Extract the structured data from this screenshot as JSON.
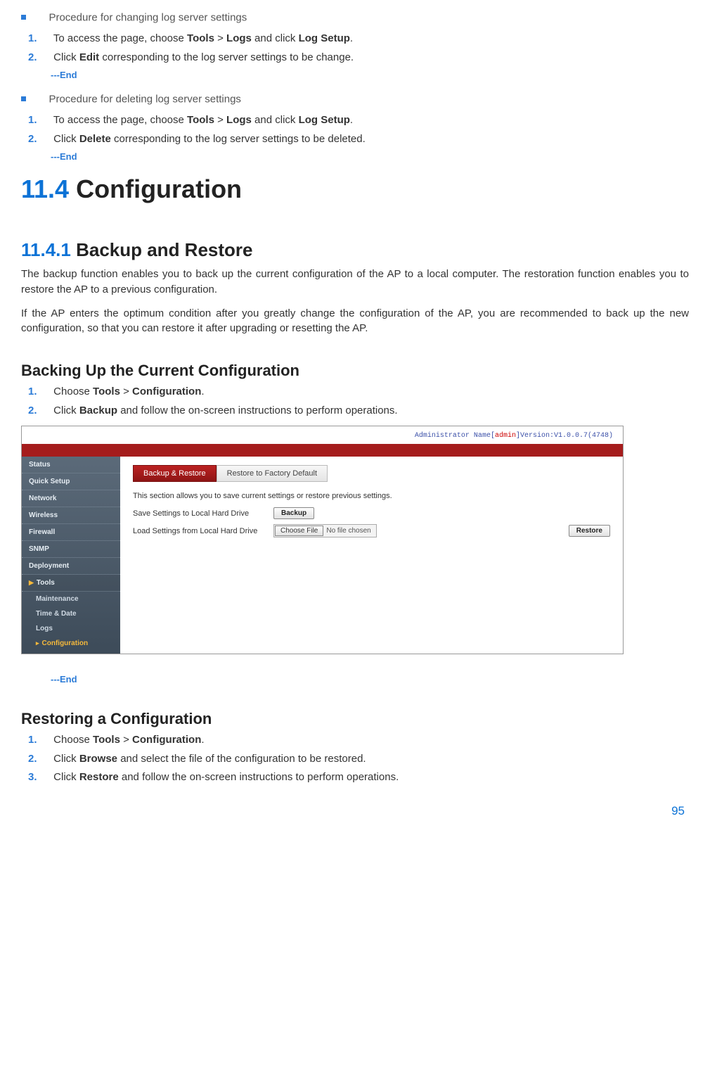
{
  "proc1": {
    "title": "Procedure for changing log server settings",
    "step1_pre": "To access the page, choose ",
    "step1_b1": "Tools",
    "step1_mid1": " > ",
    "step1_b2": "Logs",
    "step1_mid2": " and click ",
    "step1_b3": "Log Setup",
    "step1_tail": ".",
    "step2_pre": "Click ",
    "step2_b1": "Edit",
    "step2_tail": " corresponding to the log server settings to be change.",
    "end": "---End"
  },
  "proc2": {
    "title": "Procedure for deleting log server settings",
    "step1_pre": "To access the page, choose ",
    "step1_b1": "Tools",
    "step1_mid1": " > ",
    "step1_b2": "Logs",
    "step1_mid2": " and click ",
    "step1_b3": "Log Setup",
    "step1_tail": ".",
    "step2_pre": "Click ",
    "step2_b1": "Delete",
    "step2_tail": " corresponding to the log server settings to be deleted.",
    "end": "---End"
  },
  "sec": {
    "num": "11.4",
    "title": "  Configuration"
  },
  "sub": {
    "num": "11.4.1",
    "title": "  Backup and Restore"
  },
  "paras": {
    "p1": "The backup function enables you to back up the current configuration of the AP to a local computer. The restoration function enables you to restore the AP to a previous configuration.",
    "p2": "If the AP enters the optimum condition after you greatly change the configuration of the AP, you are recommended to back up the new configuration, so that you can restore it after upgrading or resetting the AP."
  },
  "backup": {
    "heading": "Backing Up the Current Configuration",
    "step1_pre": "Choose ",
    "step1_b1": "Tools",
    "step1_mid1": " > ",
    "step1_b2": "Configuration",
    "step1_tail": ".",
    "step2_pre": "Click ",
    "step2_b1": "Backup",
    "step2_tail": " and follow the on-screen instructions to perform operations.",
    "end": "---End"
  },
  "shot": {
    "admin_label_pre": "Administrator Name[",
    "admin_name": "admin",
    "admin_label_post": "]Version:V1.0.0.7(4748)",
    "side": {
      "status": "Status",
      "quick": "Quick Setup",
      "network": "Network",
      "wireless": "Wireless",
      "firewall": "Firewall",
      "snmp": "SNMP",
      "deployment": "Deployment",
      "tools": "Tools",
      "maintenance": "Maintenance",
      "timedate": "Time & Date",
      "logs": "Logs",
      "configuration": "Configuration"
    },
    "tabs": {
      "backup": "Backup & Restore",
      "factory": "Restore to Factory Default"
    },
    "desc": "This section allows you to save current settings or restore previous settings.",
    "row1_label": "Save Settings to Local Hard Drive",
    "row1_btn": "Backup",
    "row2_label": "Load Settings from Local Hard Drive",
    "row2_choose": "Choose File",
    "row2_nofile": "No file chosen",
    "row2_btn": "Restore"
  },
  "restore": {
    "heading": "Restoring a Configuration",
    "step1_pre": "Choose ",
    "step1_b1": "Tools",
    "step1_mid1": " > ",
    "step1_b2": "Configuration",
    "step1_tail": ".",
    "step2_pre": "Click ",
    "step2_b1": "Browse",
    "step2_tail": " and select the file of the configuration to be restored.",
    "step3_pre": "Click ",
    "step3_b1": "Restore",
    "step3_tail": " and follow the on-screen instructions to perform operations."
  },
  "page_number": "95"
}
